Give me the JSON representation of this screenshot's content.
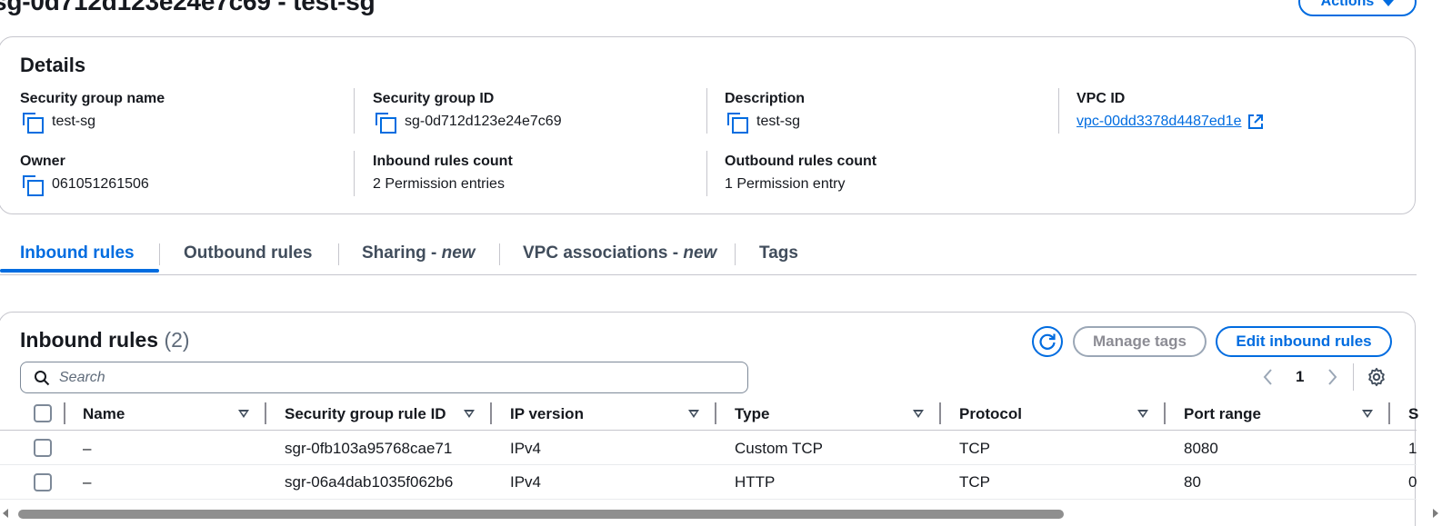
{
  "header": {
    "title": "sg-0d712d123e24e7c69 - test-sg",
    "actions_label": "Actions"
  },
  "details": {
    "title": "Details",
    "fields": {
      "sg_name": {
        "label": "Security group name",
        "value": "test-sg"
      },
      "sg_id": {
        "label": "Security group ID",
        "value": "sg-0d712d123e24e7c69"
      },
      "description": {
        "label": "Description",
        "value": "test-sg"
      },
      "vpc_id": {
        "label": "VPC ID",
        "value": "vpc-00dd3378d4487ed1e"
      },
      "owner": {
        "label": "Owner",
        "value": "061051261506"
      },
      "inbound_count": {
        "label": "Inbound rules count",
        "value": "2 Permission entries"
      },
      "outbound_count": {
        "label": "Outbound rules count",
        "value": "1 Permission entry"
      }
    }
  },
  "tabs": {
    "inbound": "Inbound rules",
    "outbound": "Outbound rules",
    "sharing": "Sharing - ",
    "sharing_new": "new",
    "vpc_assoc": "VPC associations - ",
    "vpc_assoc_new": "new",
    "tags": "Tags"
  },
  "rules": {
    "title": "Inbound rules",
    "count": "(2)",
    "manage_tags": "Manage tags",
    "edit_inbound": "Edit inbound rules",
    "search_placeholder": "Search",
    "page": "1",
    "columns": {
      "name": "Name",
      "rule_id": "Security group rule ID",
      "ip_version": "IP version",
      "type": "Type",
      "protocol": "Protocol",
      "port_range": "Port range",
      "source_partial": "S"
    },
    "rows": [
      {
        "name": "–",
        "rule_id": "sgr-0fb103a95768cae71",
        "ip_version": "IPv4",
        "type": "Custom TCP",
        "protocol": "TCP",
        "port_range": "8080",
        "source_partial": "1"
      },
      {
        "name": "–",
        "rule_id": "sgr-06a4dab1035f062b6",
        "ip_version": "IPv4",
        "type": "HTTP",
        "protocol": "TCP",
        "port_range": "80",
        "source_partial": "0"
      }
    ]
  },
  "colors": {
    "accent": "#006ce0",
    "text": "#16191f",
    "border": "#c6c6cd"
  },
  "icons": [
    "copy-icon",
    "external-link-icon",
    "refresh-icon",
    "search-icon",
    "chevron-left-icon",
    "chevron-right-icon",
    "settings-icon",
    "sort-caret-icon",
    "caret-down-icon"
  ]
}
